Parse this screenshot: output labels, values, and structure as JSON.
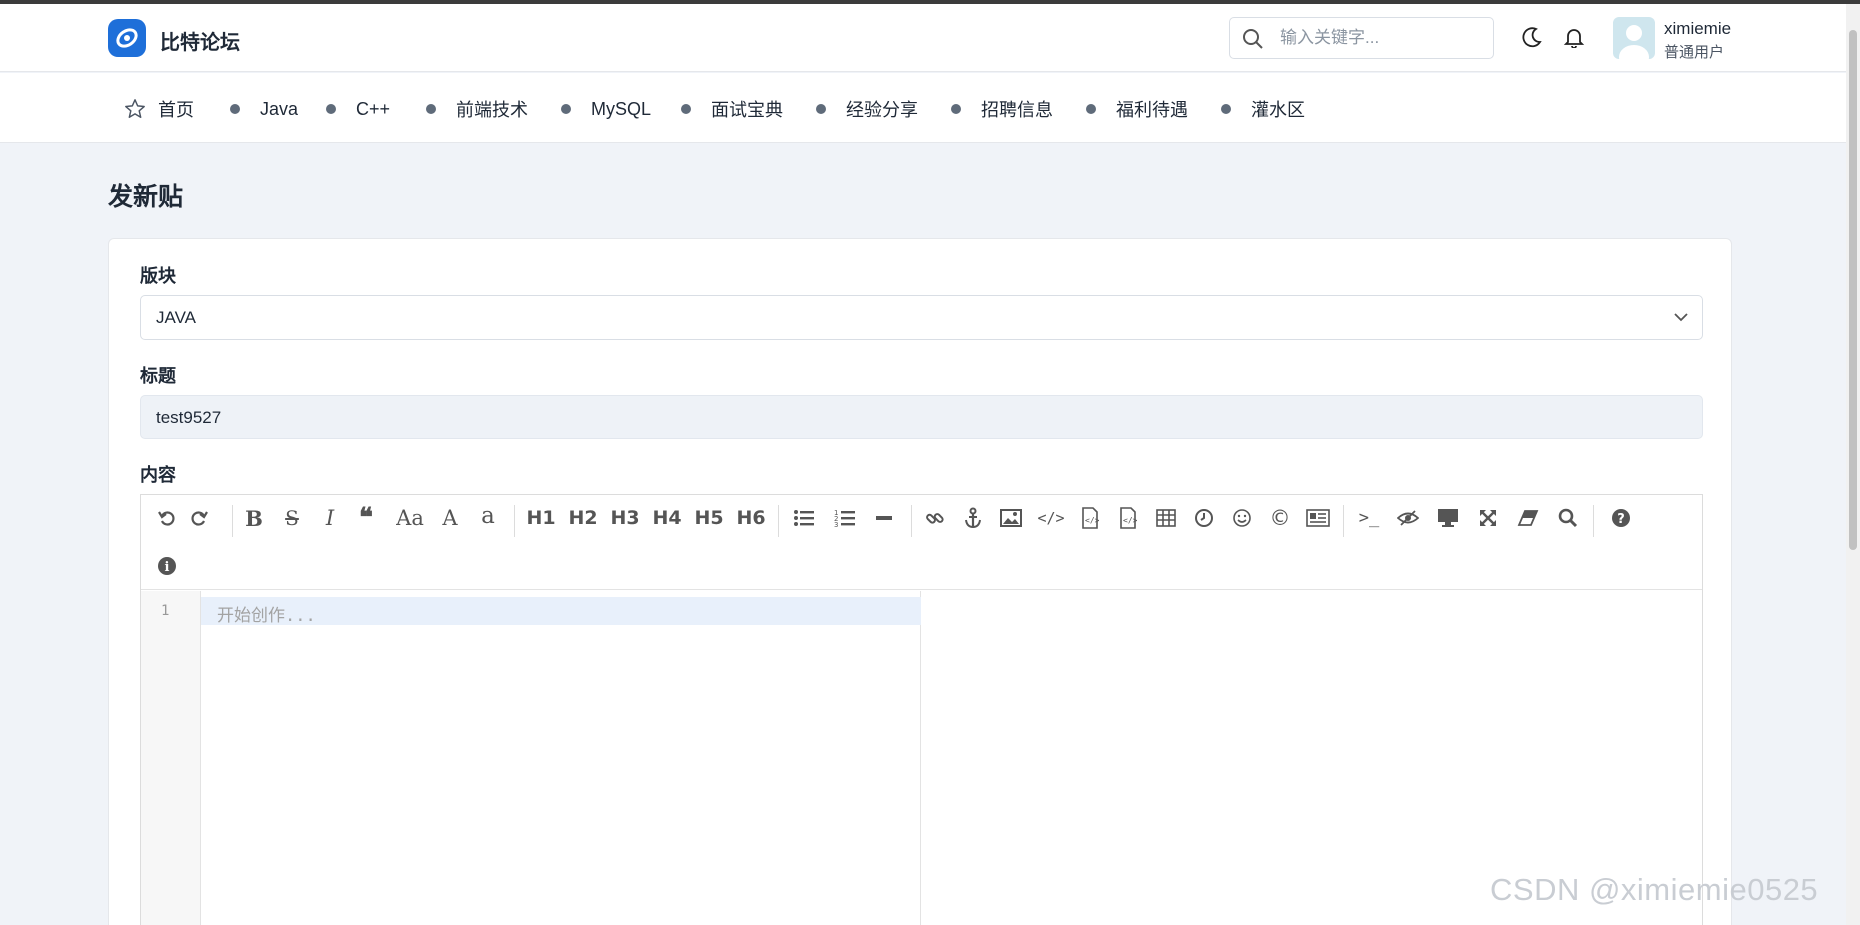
{
  "header": {
    "brand": "比特论坛",
    "search_placeholder": "输入关键字...",
    "user_name": "ximiemie",
    "user_role": "普通用户"
  },
  "nav": {
    "items": [
      "首页",
      "Java",
      "C++",
      "前端技术",
      "MySQL",
      "面试宝典",
      "经验分享",
      "招聘信息",
      "福利待遇",
      "灌水区"
    ]
  },
  "page": {
    "title": "发新贴"
  },
  "form": {
    "board_label": "版块",
    "board_value": "JAVA",
    "title_label": "标题",
    "title_value": "test9527",
    "content_label": "内容"
  },
  "editor": {
    "line_number": "1",
    "placeholder": "开始创作...",
    "heading_buttons": [
      "H1",
      "H2",
      "H3",
      "H4",
      "H5",
      "H6"
    ],
    "toolbar_icons": [
      "undo-icon",
      "redo-icon",
      "bold-icon",
      "strikethrough-icon",
      "italic-icon",
      "quote-icon",
      "uppercase-icon",
      "lowercase-first-icon",
      "lowercase-icon",
      "unordered-list-icon",
      "ordered-list-icon",
      "horizontal-rule-icon",
      "link-icon",
      "anchor-icon",
      "image-icon",
      "code-icon",
      "preformatted-code-icon",
      "code-block-icon",
      "table-icon",
      "datetime-icon",
      "emoji-icon",
      "html-entities-icon",
      "pagebreak-icon",
      "goto-line-icon",
      "watch-icon",
      "preview-icon",
      "fullscreen-icon",
      "clear-icon",
      "search-icon",
      "help-icon",
      "info-icon"
    ]
  },
  "watermark": "CSDN @ximiemie0525",
  "colors": {
    "brand": "#1e6fd9",
    "background": "#f0f3f8"
  }
}
